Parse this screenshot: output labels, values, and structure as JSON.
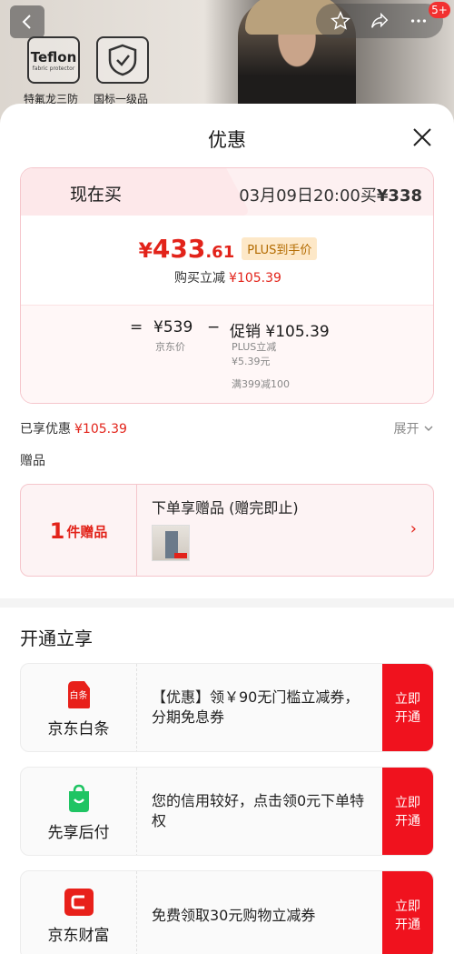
{
  "hero": {
    "teflon_text": "Teflon",
    "teflon_sub": "fabric protector",
    "caption_1": "特氟龙三防",
    "caption_2": "国标一级品",
    "notification_count": "5+"
  },
  "sheet": {
    "title": "优惠"
  },
  "price_card": {
    "tab_now": "现在买",
    "tab_later_prefix": "03月09日20:00买",
    "tab_later_price": "¥338",
    "main_price_currency": "¥",
    "main_price_int": "433",
    "main_price_dec": ".61",
    "plus_tag": "PLUS到手价",
    "reduce_label": "购买立减",
    "reduce_amount": "¥105.39",
    "eq": "=",
    "jd_price": "¥539",
    "jd_price_caption": "京东价",
    "minus": "−",
    "promo": "促销 ¥105.39",
    "promo_sub_1": "PLUS立减",
    "promo_sub_2": "¥5.39元",
    "promo_sub_3": "满399减100"
  },
  "enjoyed": {
    "label": "已享优惠",
    "amount": "¥105.39",
    "expand": "展开"
  },
  "gift": {
    "section_label": "赠品",
    "count": "1",
    "count_unit": "件赠品",
    "title": "下单享赠品 (赠完即止)",
    "arrow": "›"
  },
  "open_section": {
    "title": "开通立享",
    "services": [
      {
        "name": "京东白条",
        "icon_text": "白条",
        "text": "【优惠】领￥90无门槛立减券，分期免息券",
        "button": "立即开通"
      },
      {
        "name": "先享后付",
        "text": "您的信用较好，点击领0元下单特权",
        "button": "立即开通"
      },
      {
        "name": "京东财富",
        "text": "免费领取30元购物立减券",
        "button": "立即开通"
      }
    ]
  },
  "colors": {
    "accent_red": "#e2231a",
    "button_red": "#f0121e",
    "plus_bg": "#fde8c8",
    "plus_text": "#b36b00"
  }
}
